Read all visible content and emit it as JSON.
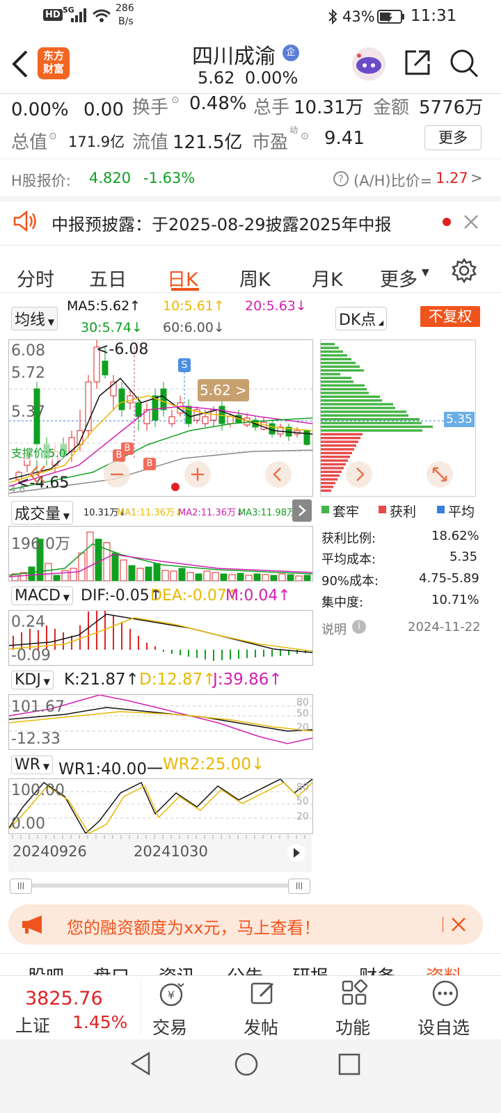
{
  "status_bar": {
    "hd": "HD",
    "net": "5G",
    "speed": "286",
    "speed_unit": "B/s",
    "battery": "43%",
    "time": "11:31"
  },
  "header": {
    "logo_line1": "东方",
    "logo_line2": "财富",
    "stock_name": "四川成渝",
    "badge": "企",
    "price": "5.62",
    "change_pct": "0.00%"
  },
  "quote": {
    "pct1": "0.00%",
    "chg": "0.00",
    "turnover_label": "换手",
    "turnover": "0.48%",
    "volume_label": "总手",
    "volume": "10.31万",
    "amount_label": "金额",
    "amount": "5776万",
    "mktcap_label": "总值",
    "mktcap": "171.9亿",
    "float_label": "流值",
    "float": "121.5亿",
    "pe_label": "市盈",
    "pe_sup": "动",
    "pe": "9.41",
    "more_btn": "更多"
  },
  "hshare": {
    "label": "H股报价:",
    "price": "4.820",
    "pct": "-1.63%",
    "ratio_label": "(A/H)比价=",
    "ratio": "1.27"
  },
  "notice": {
    "text": "中报预披露：于2025-08-29披露2025年中报"
  },
  "tabs": [
    "分时",
    "五日",
    "日K",
    "周K",
    "月K",
    "更多"
  ],
  "active_tab": "日K",
  "ma_legend": {
    "select": "均线",
    "ma5": "MA5:5.62↑",
    "ma10": "10:5.61↑",
    "ma20": "20:5.63↓",
    "ma30": "30:5.74↓",
    "ma60": "60:6.00↓"
  },
  "dk_select": "DK点",
  "fq_button": "不复权",
  "kline_labels": {
    "y1": "6.08",
    "y2": "5.72",
    "y3": "5.37",
    "high": "<-6.08",
    "low": "<-4.65",
    "price_tag": "5.62 >",
    "support": "支撑价:5.0",
    "s_mark": "S",
    "b_mark": "B",
    "left_edge": "4.6"
  },
  "vol": {
    "select": "成交量",
    "v": "10.31万↓",
    "ma1": "MA1:11.36万↓",
    "ma2": "MA2:11.36万↓",
    "ma3": "MA3:11.98万↑",
    "ymax": "196.0万"
  },
  "macd": {
    "select": "MACD",
    "dif": "DIF:-0.05↑",
    "dea": "DEA:-0.07↑",
    "m": "M:0.04↑",
    "ytop": "0.24",
    "ybot": "-0.09"
  },
  "kdj": {
    "select": "KDJ",
    "k": "K:21.87↑",
    "d": "D:12.87↑",
    "j": "J:39.86↑",
    "ytop": "101.67",
    "ybot": "-12.33",
    "r80": "80",
    "r50": "50",
    "r20": "20"
  },
  "wr": {
    "select": "WR",
    "wr1": "WR1:40.00一",
    "wr2": "WR2:25.00↓",
    "ytop": "100.00",
    "ybot": "0.00",
    "r80": "80",
    "r50": "50",
    "r20": "20"
  },
  "dates": {
    "d1": "20240926",
    "d2": "20241030"
  },
  "chip": {
    "price": "5.35",
    "legend_trapped": "套牢",
    "legend_profit": "获利",
    "legend_avg": "平均",
    "rows": [
      [
        "获利比例:",
        "18.62%"
      ],
      [
        "平均成本:",
        "5.35"
      ],
      [
        "90%成本:",
        "4.75-5.89"
      ],
      [
        "集中度:",
        "10.71%"
      ]
    ],
    "note": "说明",
    "date": "2024-11-22"
  },
  "promo": {
    "text": "您的融资额度为xx元，马上查看！"
  },
  "subtabs": [
    "股吧",
    "盘口",
    "资讯",
    "公告",
    "研报",
    "财务",
    "资料"
  ],
  "bottom": {
    "index_value": "3825.76",
    "index_name": "上证",
    "index_pct": "1.45%",
    "trade": "交易",
    "post": "发帖",
    "func": "功能",
    "watch": "设自选"
  },
  "colors": {
    "up": "#e02222",
    "down": "#10a020",
    "accent": "#f0541c",
    "ma5": "#111111",
    "ma10": "#e8b800",
    "ma20": "#d020b0",
    "ma30": "#10a020",
    "ma60": "#888888"
  }
}
